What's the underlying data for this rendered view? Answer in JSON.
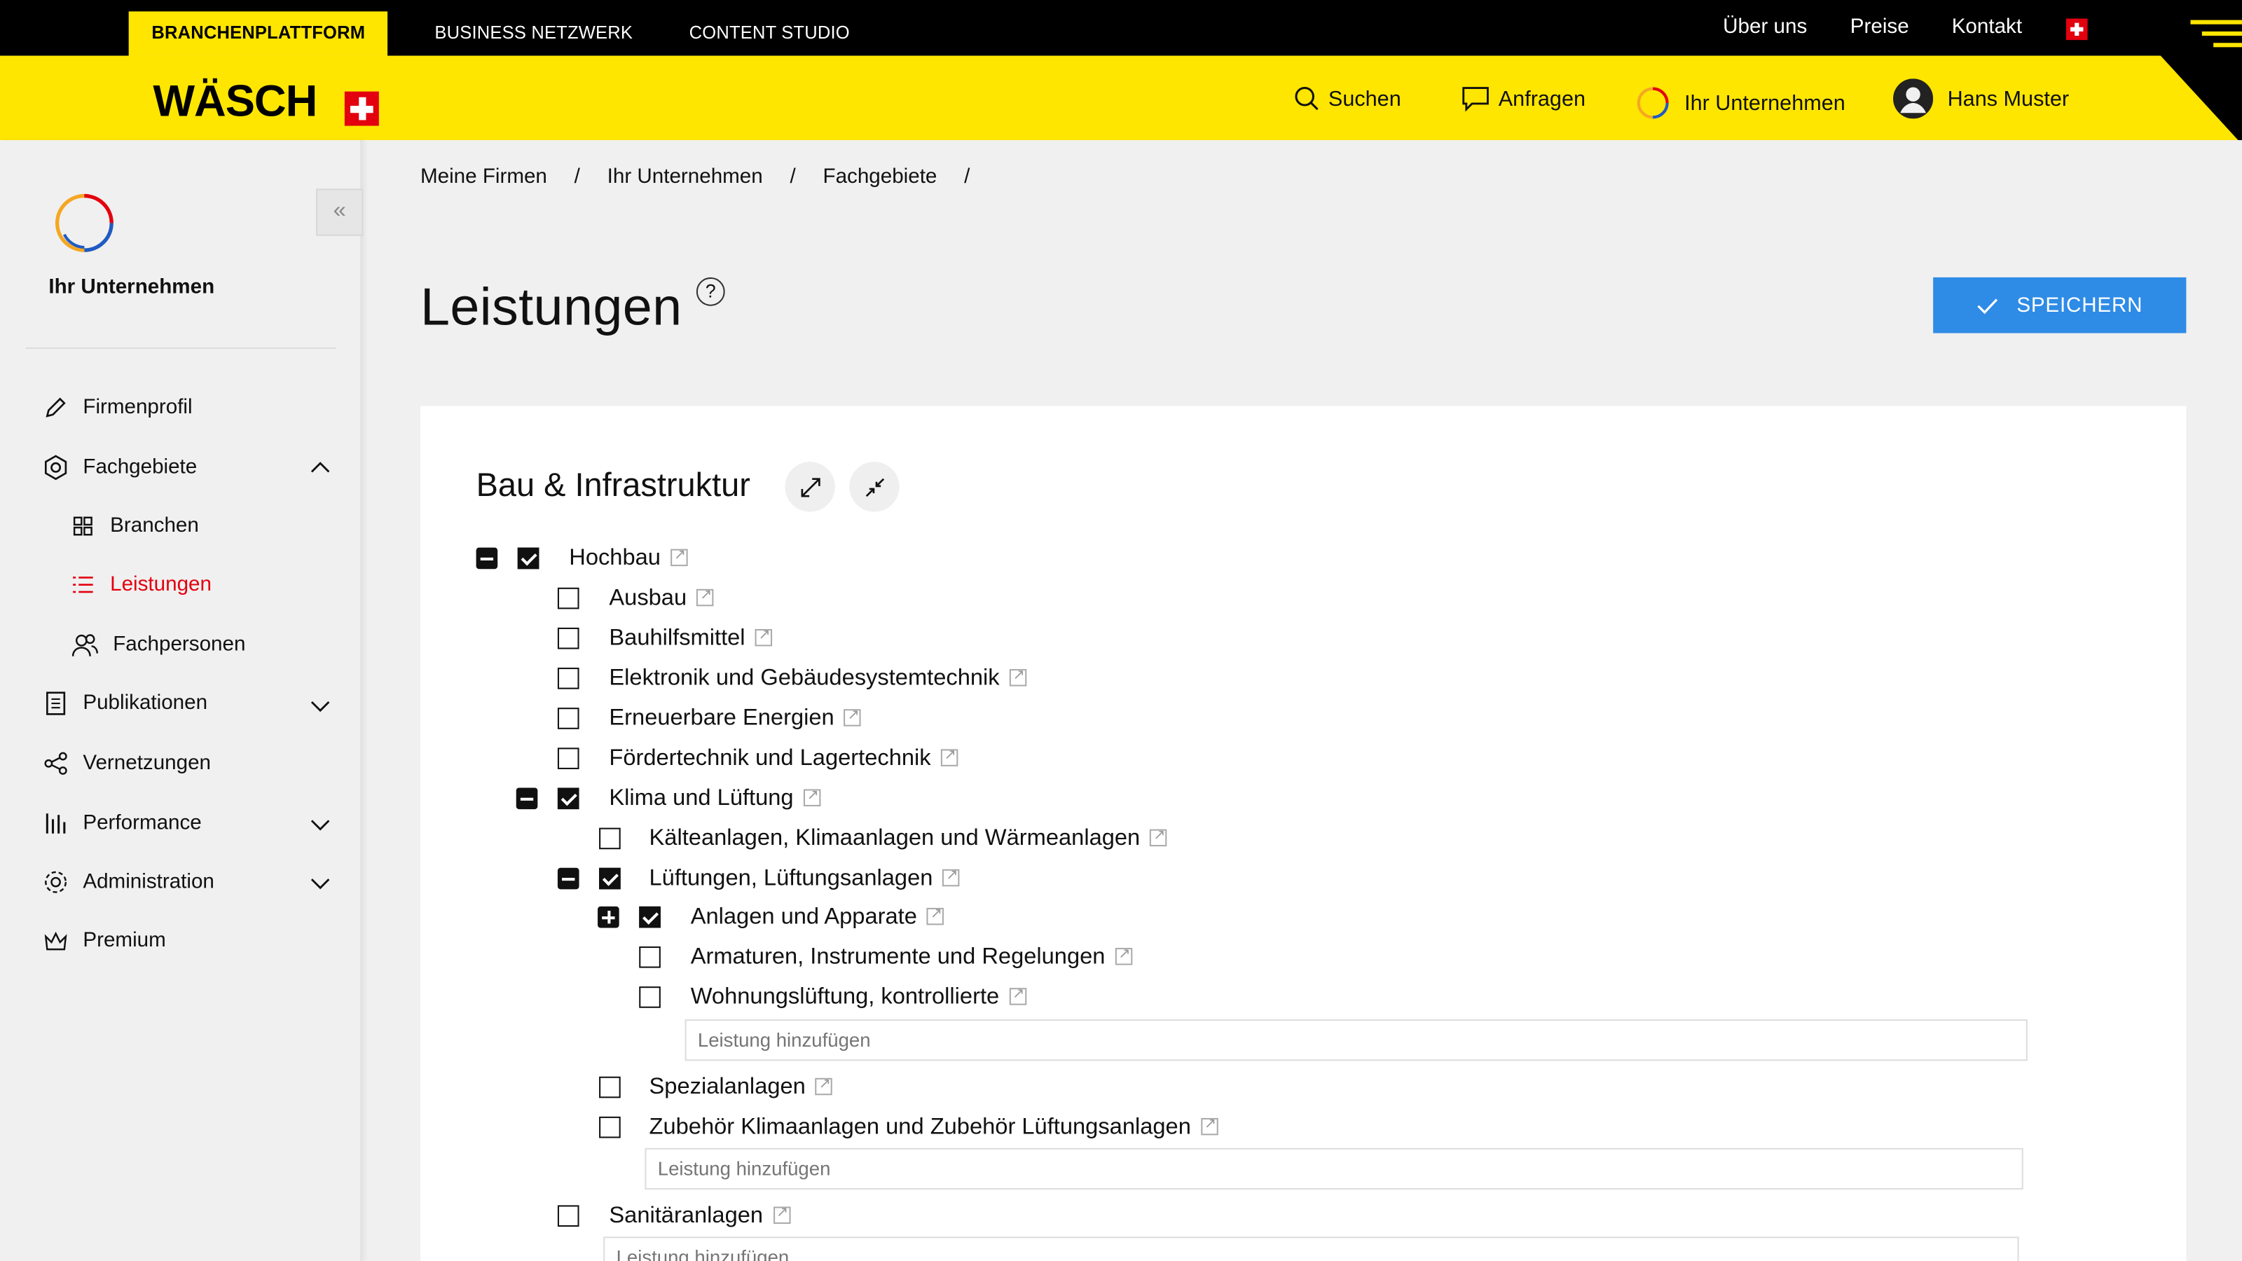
{
  "topbar": {
    "tabs": [
      "BRANCHENPLATTFORM",
      "BUSINESS NETZWERK",
      "CONTENT STUDIO"
    ],
    "links": [
      "Über uns",
      "Preise",
      "Kontakt"
    ]
  },
  "header": {
    "logo": "WÄSCH",
    "nav": {
      "search": "Suchen",
      "requests": "Anfragen",
      "company": "Ihr Unternehmen",
      "user": "Hans Muster"
    }
  },
  "sidebar": {
    "company_name": "Ihr Unternehmen",
    "collapse_glyph": "«",
    "items": [
      {
        "label": "Firmenprofil",
        "icon": "pencil-icon"
      },
      {
        "label": "Fachgebiete",
        "icon": "hexagon-icon",
        "expanded": true
      },
      {
        "label": "Branchen",
        "icon": "grid-icon"
      },
      {
        "label": "Leistungen",
        "icon": "list-icon",
        "active": true
      },
      {
        "label": "Fachpersonen",
        "icon": "people-icon"
      },
      {
        "label": "Publikationen",
        "icon": "document-icon"
      },
      {
        "label": "Vernetzungen",
        "icon": "share-icon"
      },
      {
        "label": "Performance",
        "icon": "bars-icon"
      },
      {
        "label": "Administration",
        "icon": "gear-icon"
      },
      {
        "label": "Premium",
        "icon": "crown-icon"
      }
    ]
  },
  "breadcrumb": [
    "Meine Firmen",
    "Ihr Unternehmen",
    "Fachgebiete"
  ],
  "breadcrumb_sep": "/",
  "page": {
    "title": "Leistungen",
    "help": "?",
    "save_label": "SPEICHERN"
  },
  "section": {
    "title": "Bau & Infrastruktur",
    "tree": [
      {
        "label": "Hochbau",
        "checked": true,
        "toggle": "minus"
      },
      {
        "label": "Ausbau",
        "checked": false
      },
      {
        "label": "Bauhilfsmittel",
        "checked": false
      },
      {
        "label": "Elektronik und Gebäudesystemtechnik",
        "checked": false
      },
      {
        "label": "Erneuerbare Energien",
        "checked": false
      },
      {
        "label": "Fördertechnik und Lagertechnik",
        "checked": false
      },
      {
        "label": "Klima und Lüftung",
        "checked": true,
        "toggle": "minus"
      },
      {
        "label": "Kälteanlagen, Klimaanlagen und Wärmeanlagen",
        "checked": false
      },
      {
        "label": "Lüftungen, Lüftungsanlagen",
        "checked": true,
        "toggle": "minus"
      },
      {
        "label": "Anlagen und Apparate",
        "checked": true,
        "toggle": "plus"
      },
      {
        "label": "Armaturen, Instrumente und Regelungen",
        "checked": false
      },
      {
        "label": "Wohnungslüftung, kontrollierte",
        "checked": false
      },
      {
        "label": "Spezialanlagen",
        "checked": false
      },
      {
        "label": "Zubehör Klimaanlagen und Zubehör Lüftungsanlagen",
        "checked": false
      },
      {
        "label": "Sanitäranlagen",
        "checked": false
      }
    ],
    "add_placeholder": "Leistung hinzufügen",
    "add_placeholder_partial": "Leistung hinzufügen"
  },
  "colors": {
    "brand_yellow": "#ffe600",
    "swiss_red": "#e3000f",
    "primary_blue": "#2e8be6",
    "active_red": "#e3000f"
  }
}
